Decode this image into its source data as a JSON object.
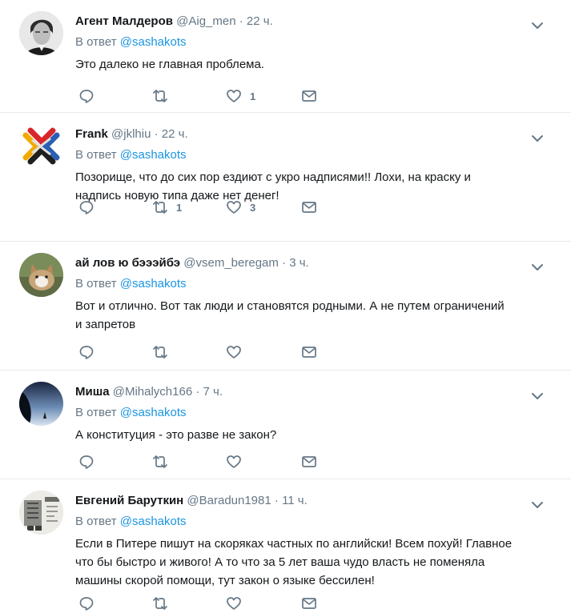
{
  "reply_prefix": "В ответ",
  "tweets": [
    {
      "name": "Агент Малдеров",
      "handle": "@Aig_men",
      "sep": "·",
      "time": "22 ч.",
      "reply_to": "@sashakots",
      "text_lines": [
        "Это далеко не главная проблема."
      ],
      "replies": "",
      "retweets": "",
      "likes": "1",
      "avatar": "man-bw-portrait"
    },
    {
      "name": "Frank",
      "handle": "@jklhiu",
      "sep": "·",
      "time": "22 ч.",
      "reply_to": "@sashakots",
      "text_lines": [
        "Позорище, что до сих пор ездиют с укро надписями!! Лохи, на краску и",
        "надпись новую типа даже нет денег!"
      ],
      "replies": "",
      "retweets": "1",
      "likes": "3",
      "avatar": "colorful-knot-logo"
    },
    {
      "name": "ай лов ю бэээйбэ",
      "handle": "@vsem_beregam",
      "sep": "·",
      "time": "3 ч.",
      "reply_to": "@sashakots",
      "text_lines": [
        "Вот и отлично. Вот так люди и становятся родными. А не путем ограничений",
        "и запретов"
      ],
      "replies": "",
      "retweets": "",
      "likes": "",
      "avatar": "cat-photo"
    },
    {
      "name": "Миша",
      "handle": "@Mihalych166",
      "sep": "·",
      "time": "7 ч.",
      "reply_to": "@sashakots",
      "text_lines": [
        "А конституция - это разве не закон?"
      ],
      "replies": "",
      "retweets": "",
      "likes": "",
      "avatar": "night-sky-photo"
    },
    {
      "name": "Евгений Баруткин",
      "handle": "@Baradun1981",
      "sep": "·",
      "time": "11 ч.",
      "reply_to": "@sashakots",
      "text_lines": [
        "Если в Питере пишут на скоряках частных по английски! Всем похуй! Главное",
        "что бы быстро  и живого! А то что за 5 лет ваша чудо власть не поменяла",
        "машины скорой помощи, тут закон о языке бессилен!"
      ],
      "replies": "",
      "retweets": "",
      "likes": "",
      "avatar": "robot-figure-photo"
    }
  ],
  "colors": {
    "text": "#14171a",
    "secondary": "#657786",
    "link": "#1b95e0",
    "divider": "#e6ecf0"
  }
}
